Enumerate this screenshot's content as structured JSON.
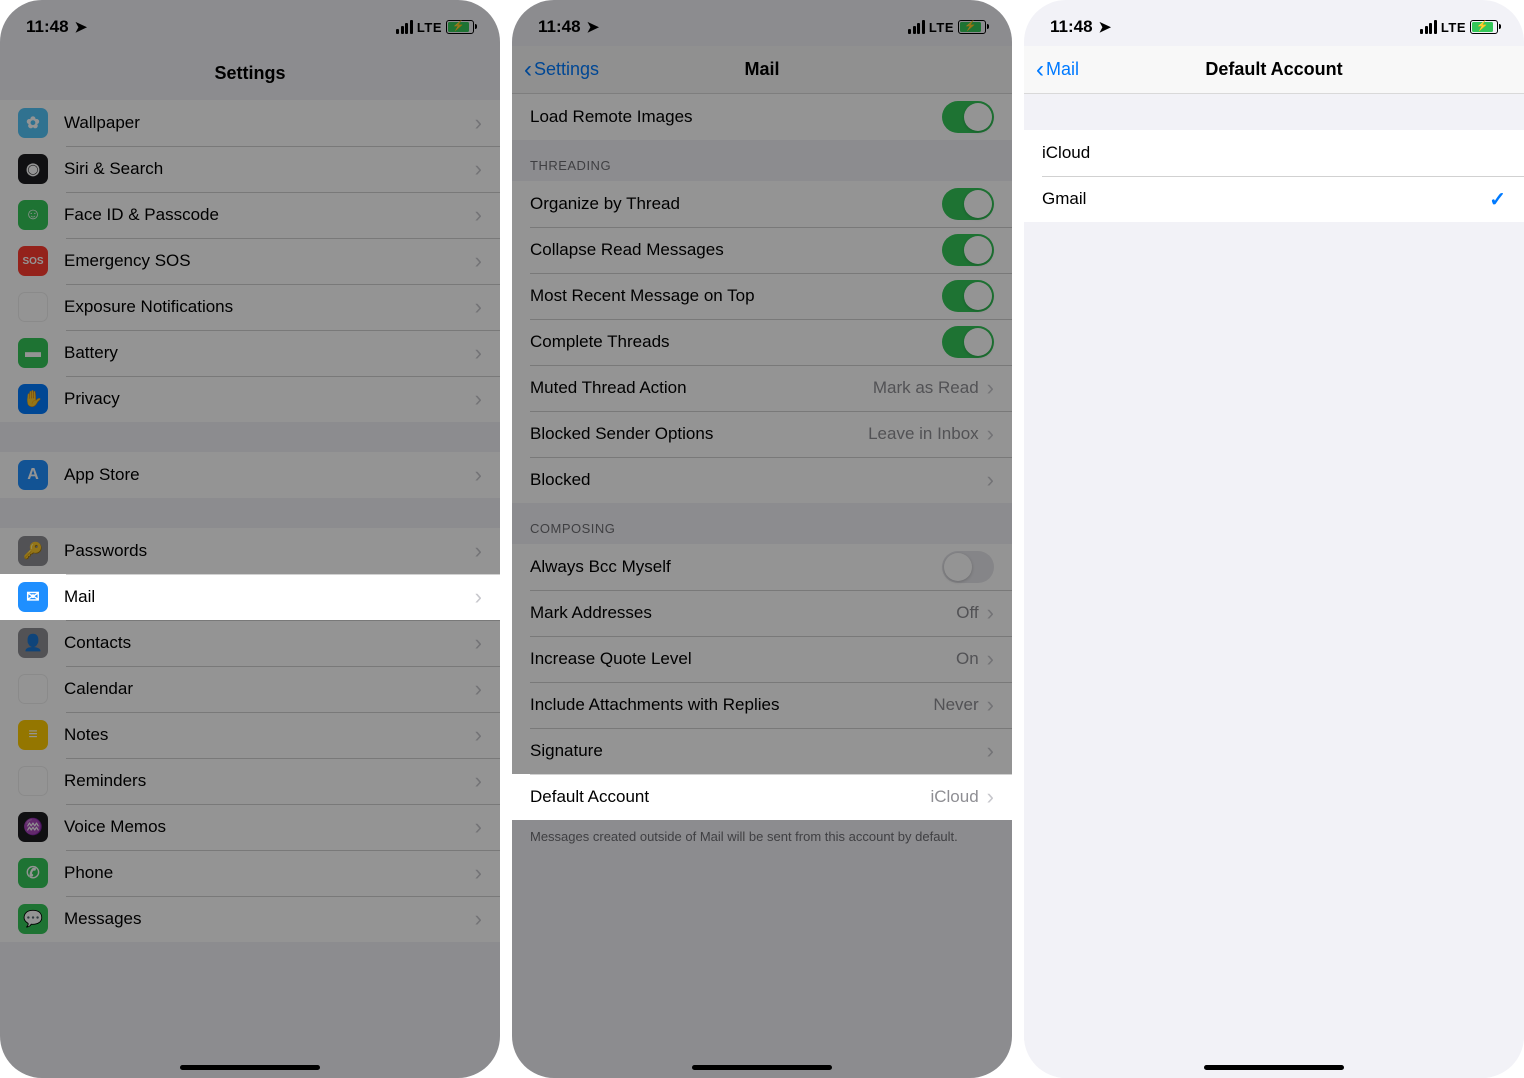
{
  "status": {
    "time": "11:48",
    "carrier": "LTE"
  },
  "screen1": {
    "title": "Settings",
    "items": [
      {
        "label": "Wallpaper",
        "icon": "wallpaper",
        "glyph": "✿"
      },
      {
        "label": "Siri & Search",
        "icon": "siri",
        "glyph": "◉"
      },
      {
        "label": "Face ID & Passcode",
        "icon": "faceid",
        "glyph": "☺"
      },
      {
        "label": "Emergency SOS",
        "icon": "sos",
        "glyph": "SOS"
      },
      {
        "label": "Exposure Notifications",
        "icon": "exposure",
        "glyph": "☀"
      },
      {
        "label": "Battery",
        "icon": "battery",
        "glyph": "▬"
      },
      {
        "label": "Privacy",
        "icon": "privacy",
        "glyph": "✋"
      }
    ],
    "items2": [
      {
        "label": "App Store",
        "icon": "appstore",
        "glyph": "A"
      }
    ],
    "items3": [
      {
        "label": "Passwords",
        "icon": "passwords",
        "glyph": "🔑"
      },
      {
        "label": "Mail",
        "icon": "mail",
        "glyph": "✉",
        "highlight": true
      },
      {
        "label": "Contacts",
        "icon": "contacts",
        "glyph": "👤"
      },
      {
        "label": "Calendar",
        "icon": "calendar",
        "glyph": "▦"
      },
      {
        "label": "Notes",
        "icon": "notes",
        "glyph": "≡"
      },
      {
        "label": "Reminders",
        "icon": "reminders",
        "glyph": "⋮"
      },
      {
        "label": "Voice Memos",
        "icon": "voice",
        "glyph": "♒"
      },
      {
        "label": "Phone",
        "icon": "phone",
        "glyph": "✆"
      },
      {
        "label": "Messages",
        "icon": "messages",
        "glyph": "💬"
      }
    ]
  },
  "screen2": {
    "back": "Settings",
    "title": "Mail",
    "row_load_remote": "Load Remote Images",
    "section_threading": "THREADING",
    "rows_threading": [
      {
        "label": "Organize by Thread",
        "toggle": true
      },
      {
        "label": "Collapse Read Messages",
        "toggle": true
      },
      {
        "label": "Most Recent Message on Top",
        "toggle": true
      },
      {
        "label": "Complete Threads",
        "toggle": true
      },
      {
        "label": "Muted Thread Action",
        "value": "Mark as Read"
      },
      {
        "label": "Blocked Sender Options",
        "value": "Leave in Inbox"
      },
      {
        "label": "Blocked"
      }
    ],
    "section_composing": "COMPOSING",
    "rows_composing": [
      {
        "label": "Always Bcc Myself",
        "toggle": false
      },
      {
        "label": "Mark Addresses",
        "value": "Off"
      },
      {
        "label": "Increase Quote Level",
        "value": "On"
      },
      {
        "label": "Include Attachments with Replies",
        "value": "Never"
      },
      {
        "label": "Signature"
      },
      {
        "label": "Default Account",
        "value": "iCloud",
        "highlight": true
      }
    ],
    "footer": "Messages created outside of Mail will be sent from this account by default."
  },
  "screen3": {
    "back": "Mail",
    "title": "Default Account",
    "options": [
      {
        "label": "iCloud",
        "checked": false
      },
      {
        "label": "Gmail",
        "checked": true
      }
    ]
  }
}
